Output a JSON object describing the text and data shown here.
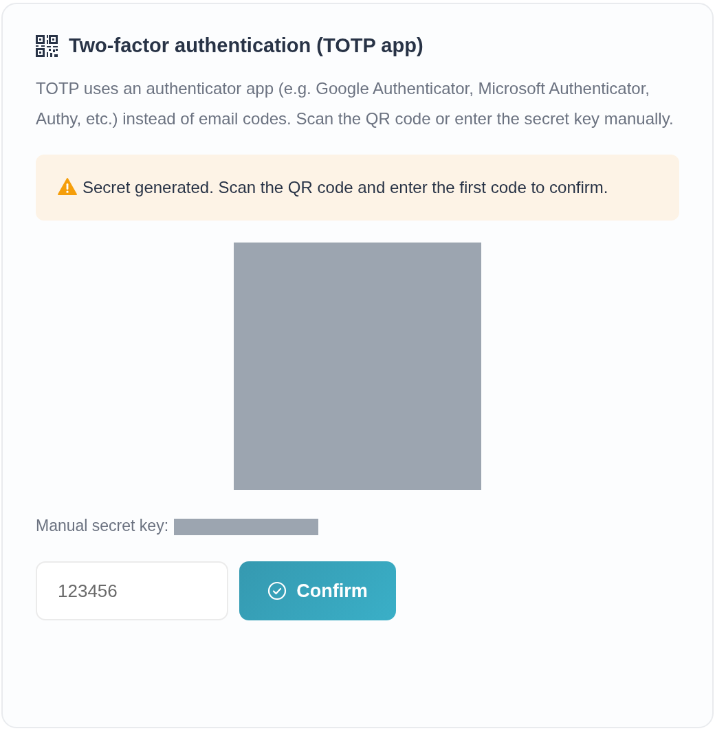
{
  "title": "Two-factor authentication (TOTP app)",
  "description": "TOTP uses an authenticator app (e.g. Google Authenticator, Microsoft Authenticator, Authy, etc.) instead of email codes. Scan the QR code or enter the secret key manually.",
  "alert": {
    "kind": "warning",
    "text": "Secret generated. Scan the QR code and enter the first code to confirm."
  },
  "manual_key_label": "Manual secret key:",
  "code_field": {
    "placeholder": "123456"
  },
  "confirm_button": {
    "label": "Confirm"
  }
}
